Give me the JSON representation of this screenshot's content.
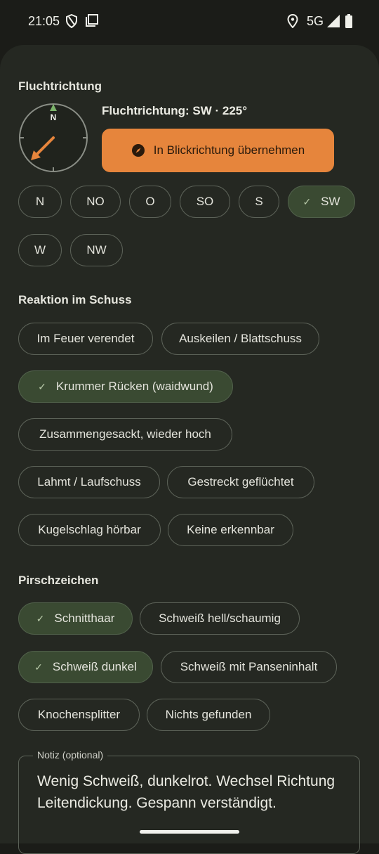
{
  "status_bar": {
    "time": "21:05",
    "network": "5G"
  },
  "sheet": {
    "section_flight": "Fluchtrichtung",
    "compass": {
      "north_label": "N",
      "bearing_deg": 225
    },
    "direction_readout": "Fluchtrichtung: SW · 225°",
    "adopt_button": "In Blickrichtung übernehmen",
    "directions": [
      "N",
      "NO",
      "O",
      "SO",
      "S",
      "SW",
      "W",
      "NW"
    ],
    "selected_direction": "SW",
    "section_reaction": "Reaktion im Schuss",
    "reactions": [
      "Im Feuer verendet",
      "Auskeilen / Blattschuss",
      "Krummer Rücken (waidwund)",
      "Zusammengesackt, wieder hoch",
      "Lahmt / Laufschuss",
      "Gestreckt geflüchtet",
      "Kugelschlag hörbar",
      "Keine erkennbar"
    ],
    "selected_reaction": "Krummer Rücken (waidwund)",
    "section_signs": "Pirschzeichen",
    "signs": [
      "Schnitthaar",
      "Schweiß hell/schaumig",
      "Schweiß dunkel",
      "Schweiß mit Panseninhalt",
      "Knochensplitter",
      "Nichts gefunden"
    ],
    "selected_signs": [
      "Schnitthaar",
      "Schweiß dunkel"
    ],
    "note_label": "Notiz (optional)",
    "note_value": "Wenig Schweiß, dunkelrot. Wechsel Richtung Leitendickung. Gespann verständigt."
  },
  "colors": {
    "accent_orange": "#e6853c",
    "selected_chip": "#3a4a32",
    "background": "#252822"
  }
}
